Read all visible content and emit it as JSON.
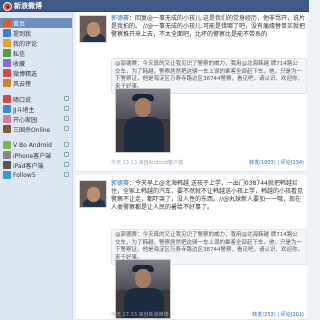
{
  "app": {
    "logo_text": "新浪微博"
  },
  "sidebar": {
    "items": [
      {
        "label": "首页",
        "icon": "home-icon",
        "color": "#e05a2b"
      },
      {
        "label": "提到我",
        "icon": "at-icon",
        "color": "#3b7dd8"
      },
      {
        "label": "我的评论",
        "icon": "comment-icon",
        "color": "#e0a32b"
      },
      {
        "label": "私信",
        "icon": "mail-icon",
        "color": "#5a9a3a"
      },
      {
        "label": "收藏",
        "icon": "star-icon",
        "color": "#8a6ad0"
      },
      {
        "label": "微博精选",
        "icon": "hot-icon",
        "color": "#d04a4a"
      },
      {
        "label": "风云榜",
        "icon": "trophy-icon",
        "color": "#c08a2b"
      }
    ],
    "groups": [
      {
        "label": "随口说",
        "icon": "grid-icon",
        "color": "#d04a4a"
      },
      {
        "label": "JJ斗地主",
        "icon": "cards-icon",
        "color": "#3a8ad0"
      },
      {
        "label": "开心家园",
        "icon": "heart-icon",
        "color": "#e07a9a"
      },
      {
        "label": "三国杀Online",
        "icon": "game-icon",
        "color": "#7a5a3a"
      }
    ],
    "clients": [
      {
        "label": "V Bo Android",
        "icon": "android-icon",
        "color": "#7ab84a"
      },
      {
        "label": "iPhone客户端",
        "icon": "iphone-icon",
        "color": "#888888"
      },
      {
        "label": "iPad客户端",
        "icon": "ipad-icon",
        "color": "#555555"
      },
      {
        "label": "Follow5",
        "icon": "follow5-icon",
        "color": "#3a9ad0"
      }
    ]
  },
  "posts": [
    {
      "author": "郭德赛",
      "text": "：回复@一事无成的小孩儿:这是我们的党身经历，他非骂开，说片是我拍的。 //@一事无成的小孩儿:可能是错哪了吧，没有痛缘替单买就把警察推开来上去，不太全面吧，比坏的警察比是能不带系的",
      "repost_text": "@郭德赛：今天真的又让我见识了警察的威力，我用@北海韩越 牌714路公交车，为了韩越，警察居然把这辆一车上误的乘客全部赶下车，他，只是为一下警察证。他是海淀区万寿寺路边区38744警察，看见吧，请认识、欢迎你，来干好事。",
      "meta": "今天 13:13  来自Android客户端",
      "actions": "转发(1003) | 评论(234)"
    },
    {
      "author": "郭德赛",
      "text": "：今天早上@北海韩越 送孩子上学，一出门038744就把韩越拦住，全家上韩越的汽车，要不然就不让韩越送小孩上学，韩越的小孩看见警察不让走，都吓哭了，没人性的东西。//@丸球新人要加一一哦，现在人类警察都是让人民的暑给不好事了。",
      "repost_text": "@郭德赛：今天真的又让我见识了警察的威力，我用@北海韩越 牌714路公交车，为了韩越，警察居然把这辆一车上误的乘客全部赶下车，他，只是为一下警察证。他是海淀区万寿寺路边区38744警察，看见吧，请认识、欢迎你，来干好事。",
      "meta": "今天 17:33  来自新浪微博",
      "actions": "转发(253) | 评论(201)"
    }
  ]
}
